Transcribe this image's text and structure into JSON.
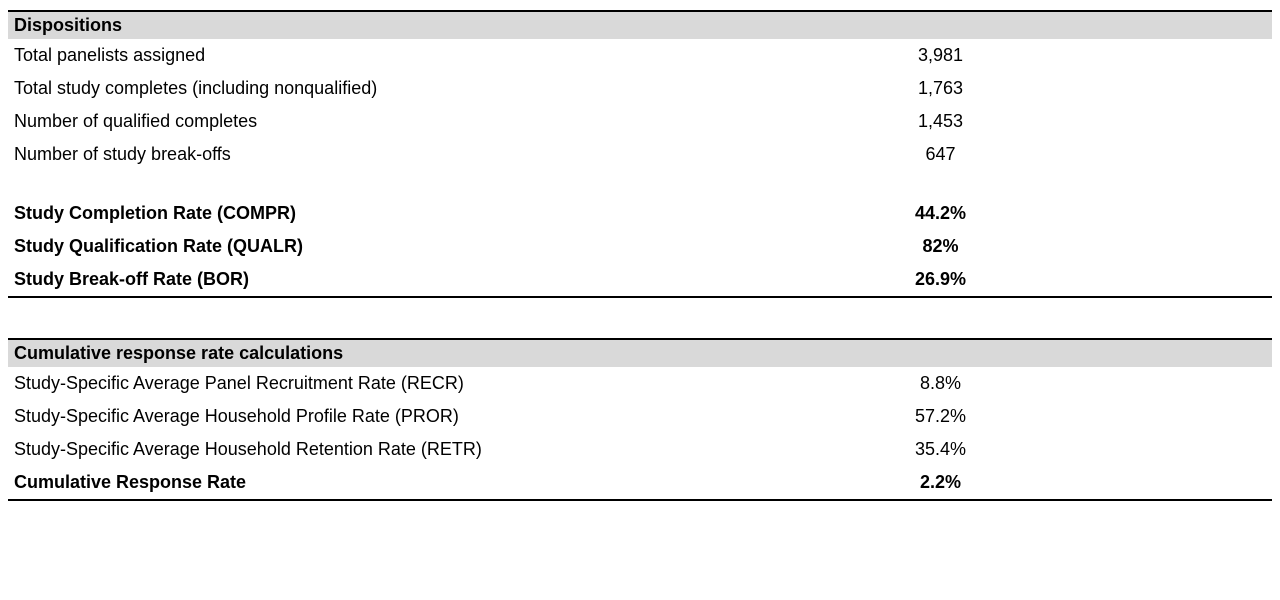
{
  "tables": [
    {
      "header": "Dispositions",
      "rows": [
        {
          "label": "Total panelists assigned",
          "value": "3,981",
          "bold": false
        },
        {
          "label": "Total study completes (including nonqualified)",
          "value": "1,763",
          "bold": false
        },
        {
          "label": "Number of qualified completes",
          "value": "1,453",
          "bold": false
        },
        {
          "label": "Number of study break-offs",
          "value": "647",
          "bold": false
        }
      ],
      "summary": [
        {
          "label": "Study Completion Rate (COMPR)",
          "value": "44.2%",
          "bold": true
        },
        {
          "label": "Study Qualification Rate (QUALR)",
          "value": "82%",
          "bold": true
        },
        {
          "label": "Study Break-off Rate (BOR)",
          "value": "26.9%",
          "bold": true
        }
      ]
    },
    {
      "header": "Cumulative response rate calculations",
      "rows": [
        {
          "label": "Study-Specific Average Panel Recruitment Rate (RECR)",
          "value": "8.8%",
          "bold": false
        },
        {
          "label": "Study-Specific Average Household Profile Rate (PROR)",
          "value": "57.2%",
          "bold": false
        },
        {
          "label": "Study-Specific Average Household Retention Rate (RETR)",
          "value": "35.4%",
          "bold": false
        },
        {
          "label": "Cumulative Response Rate",
          "value": "2.2%",
          "bold": true
        }
      ],
      "summary": []
    }
  ]
}
